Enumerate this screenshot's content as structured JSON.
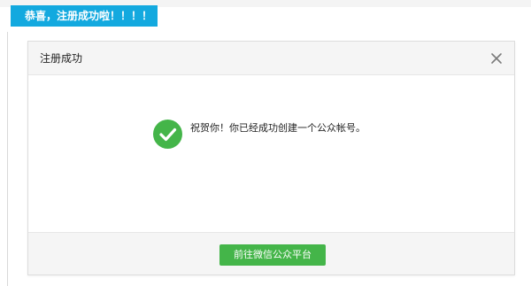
{
  "banner": {
    "text": "恭喜，注册成功啦！！！！"
  },
  "dialog": {
    "title": "注册成功",
    "close_icon": "close-icon",
    "message": "祝贺你！你已经成功创建一个公众帐号。",
    "success_icon": "check-circle-icon",
    "primary_button": "前往微信公众平台"
  },
  "colors": {
    "banner": "#13a9df",
    "success": "#44b549",
    "button": "#44b549",
    "header_bg": "#f5f5f5"
  }
}
